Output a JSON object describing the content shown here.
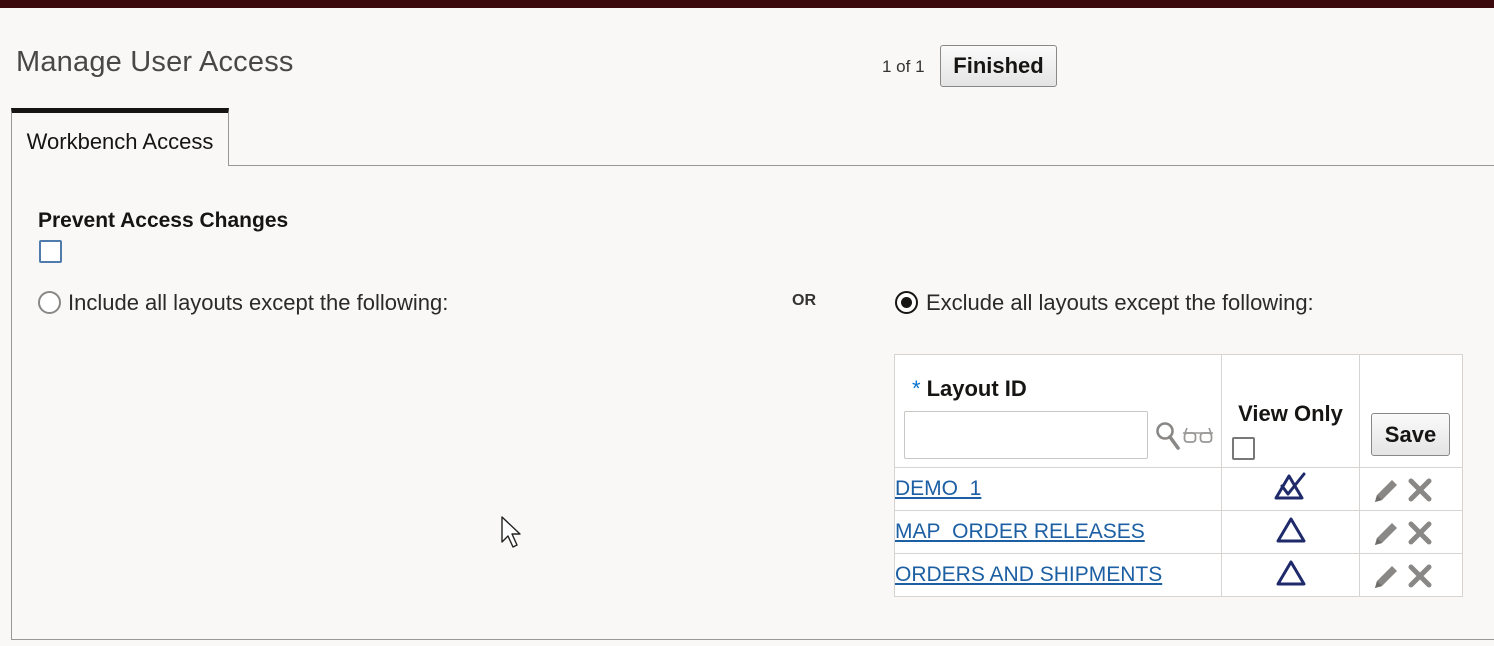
{
  "page": {
    "title": "Manage User Access"
  },
  "pager": {
    "counter": "1 of 1",
    "finished_label": "Finished"
  },
  "tabs": [
    {
      "label": "Workbench Access",
      "active": true
    }
  ],
  "prevent_access": {
    "label": "Prevent Access Changes",
    "checked": false
  },
  "options": {
    "include_label": "Include all layouts except the following:",
    "or_label": "OR",
    "exclude_label": "Exclude all layouts except the following:",
    "selected": "exclude"
  },
  "layout_table": {
    "required_marker": "*",
    "layout_id_header": "Layout ID",
    "layout_id_input_value": "",
    "view_only_header": "View Only",
    "save_label": "Save",
    "rows": [
      {
        "layout_id": "DEMO_1",
        "view_only_icon": "checked-triangle-icon"
      },
      {
        "layout_id": "MAP_ORDER RELEASES",
        "view_only_icon": "triangle-icon"
      },
      {
        "layout_id": "ORDERS AND SHIPMENTS",
        "view_only_icon": "triangle-icon"
      }
    ]
  },
  "colors": {
    "top_bar": "#3a0a0c",
    "link": "#1c5fa3",
    "required": "#0572ce",
    "checkbox_border": "#4f7cac",
    "view_only_icon": "#1f2a6b"
  }
}
